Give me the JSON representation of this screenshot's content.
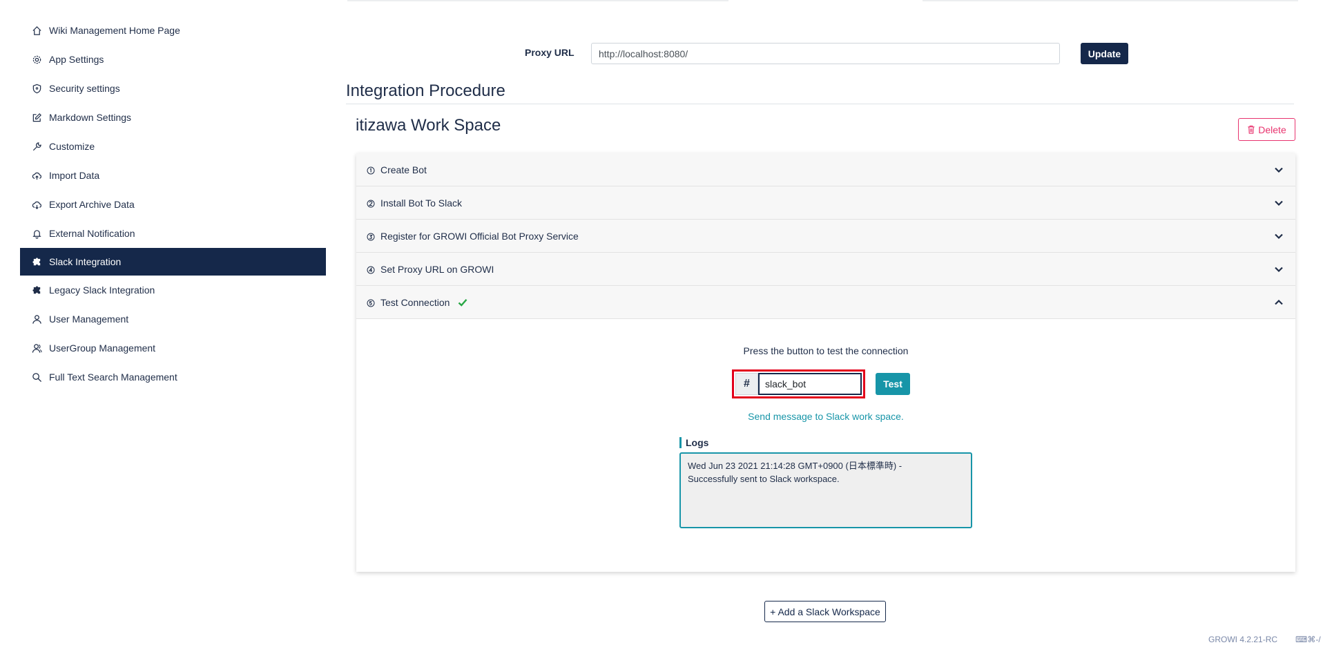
{
  "sidebar": {
    "items": [
      {
        "label": "Wiki Management Home Page",
        "icon": "home-icon"
      },
      {
        "label": "App Settings",
        "icon": "gear-icon"
      },
      {
        "label": "Security settings",
        "icon": "shield-icon"
      },
      {
        "label": "Markdown Settings",
        "icon": "edit-icon"
      },
      {
        "label": "Customize",
        "icon": "wrench-icon"
      },
      {
        "label": "Import Data",
        "icon": "cloud-upload-icon"
      },
      {
        "label": "Export Archive Data",
        "icon": "cloud-download-icon"
      },
      {
        "label": "External Notification",
        "icon": "bell-icon"
      },
      {
        "label": "Slack Integration",
        "icon": "puzzle-icon",
        "active": true
      },
      {
        "label": "Legacy Slack Integration",
        "icon": "puzzle-icon"
      },
      {
        "label": "User Management",
        "icon": "user-icon"
      },
      {
        "label": "UserGroup Management",
        "icon": "users-icon"
      },
      {
        "label": "Full Text Search Management",
        "icon": "search-icon"
      }
    ]
  },
  "proxy": {
    "label": "Proxy URL",
    "value": "http://localhost:8080/",
    "update_label": "Update"
  },
  "section_title": "Integration Procedure",
  "workspace": {
    "name": "itizawa Work Space",
    "delete_label": "Delete"
  },
  "steps": [
    {
      "number": "①",
      "label": "Create Bot"
    },
    {
      "number": "②",
      "label": "Install Bot To Slack"
    },
    {
      "number": "③",
      "label": "Register for GROWI Official Bot Proxy Service"
    },
    {
      "number": "④",
      "label": "Set Proxy URL on GROWI"
    },
    {
      "number": "⑤",
      "label": "Test Connection",
      "completed": true,
      "expanded": true
    }
  ],
  "test_connection": {
    "caption": "Press the button to test the connection",
    "hash": "#",
    "channel_value": "slack_bot",
    "test_label": "Test",
    "send_message": "Send message to Slack work space.",
    "logs_label": "Logs",
    "logs_text": "Wed Jun 23 2021 21:14:28 GMT+0900 (日本標準時) -\nSuccessfully sent to Slack workspace."
  },
  "add_workspace_label": "+ Add a Slack Workspace",
  "footer": {
    "version": "GROWI 4.2.21-RC",
    "shortcut": "⌨⌘-/"
  },
  "colors": {
    "primary": "#15284a",
    "accent": "#1795a8",
    "danger": "#e8336e",
    "success": "#28a745",
    "highlight": "#e3001b"
  }
}
